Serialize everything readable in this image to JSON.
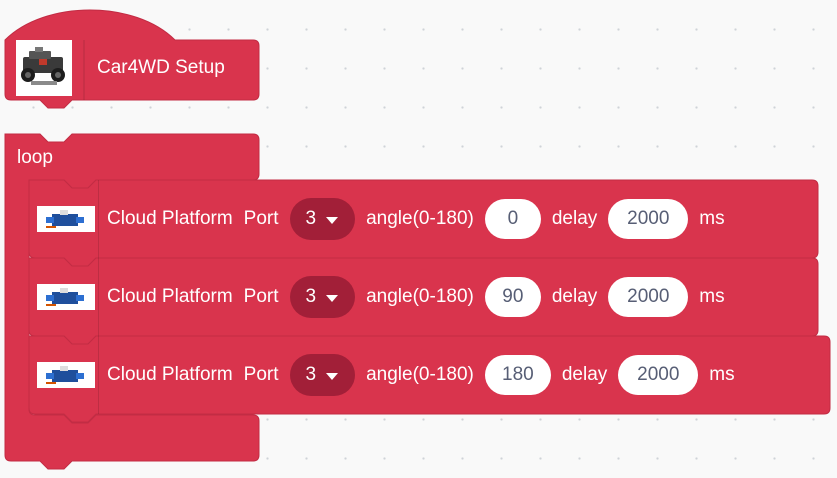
{
  "colors": {
    "block": "#d9344d",
    "block_dark": "#a21f38",
    "workspace_bg": "#f9f9f9",
    "text": "#ffffff",
    "field_text": "#575e75"
  },
  "icons": {
    "setup": "car-robot-icon",
    "servo": "servo-motor-icon",
    "dropdown": "caret-down-icon"
  },
  "setup_block": {
    "label": "Car4WD Setup"
  },
  "loop_block": {
    "label": "loop"
  },
  "statements": [
    {
      "title": "Cloud Platform",
      "port_label": "Port",
      "port_value": "3",
      "angle_label": "angle(0-180)",
      "angle": "0",
      "delay_label": "delay",
      "delay": "2000",
      "unit": "ms"
    },
    {
      "title": "Cloud Platform",
      "port_label": "Port",
      "port_value": "3",
      "angle_label": "angle(0-180)",
      "angle": "90",
      "delay_label": "delay",
      "delay": "2000",
      "unit": "ms"
    },
    {
      "title": "Cloud Platform",
      "port_label": "Port",
      "port_value": "3",
      "angle_label": "angle(0-180)",
      "angle": "180",
      "delay_label": "delay",
      "delay": "2000",
      "unit": "ms"
    }
  ]
}
